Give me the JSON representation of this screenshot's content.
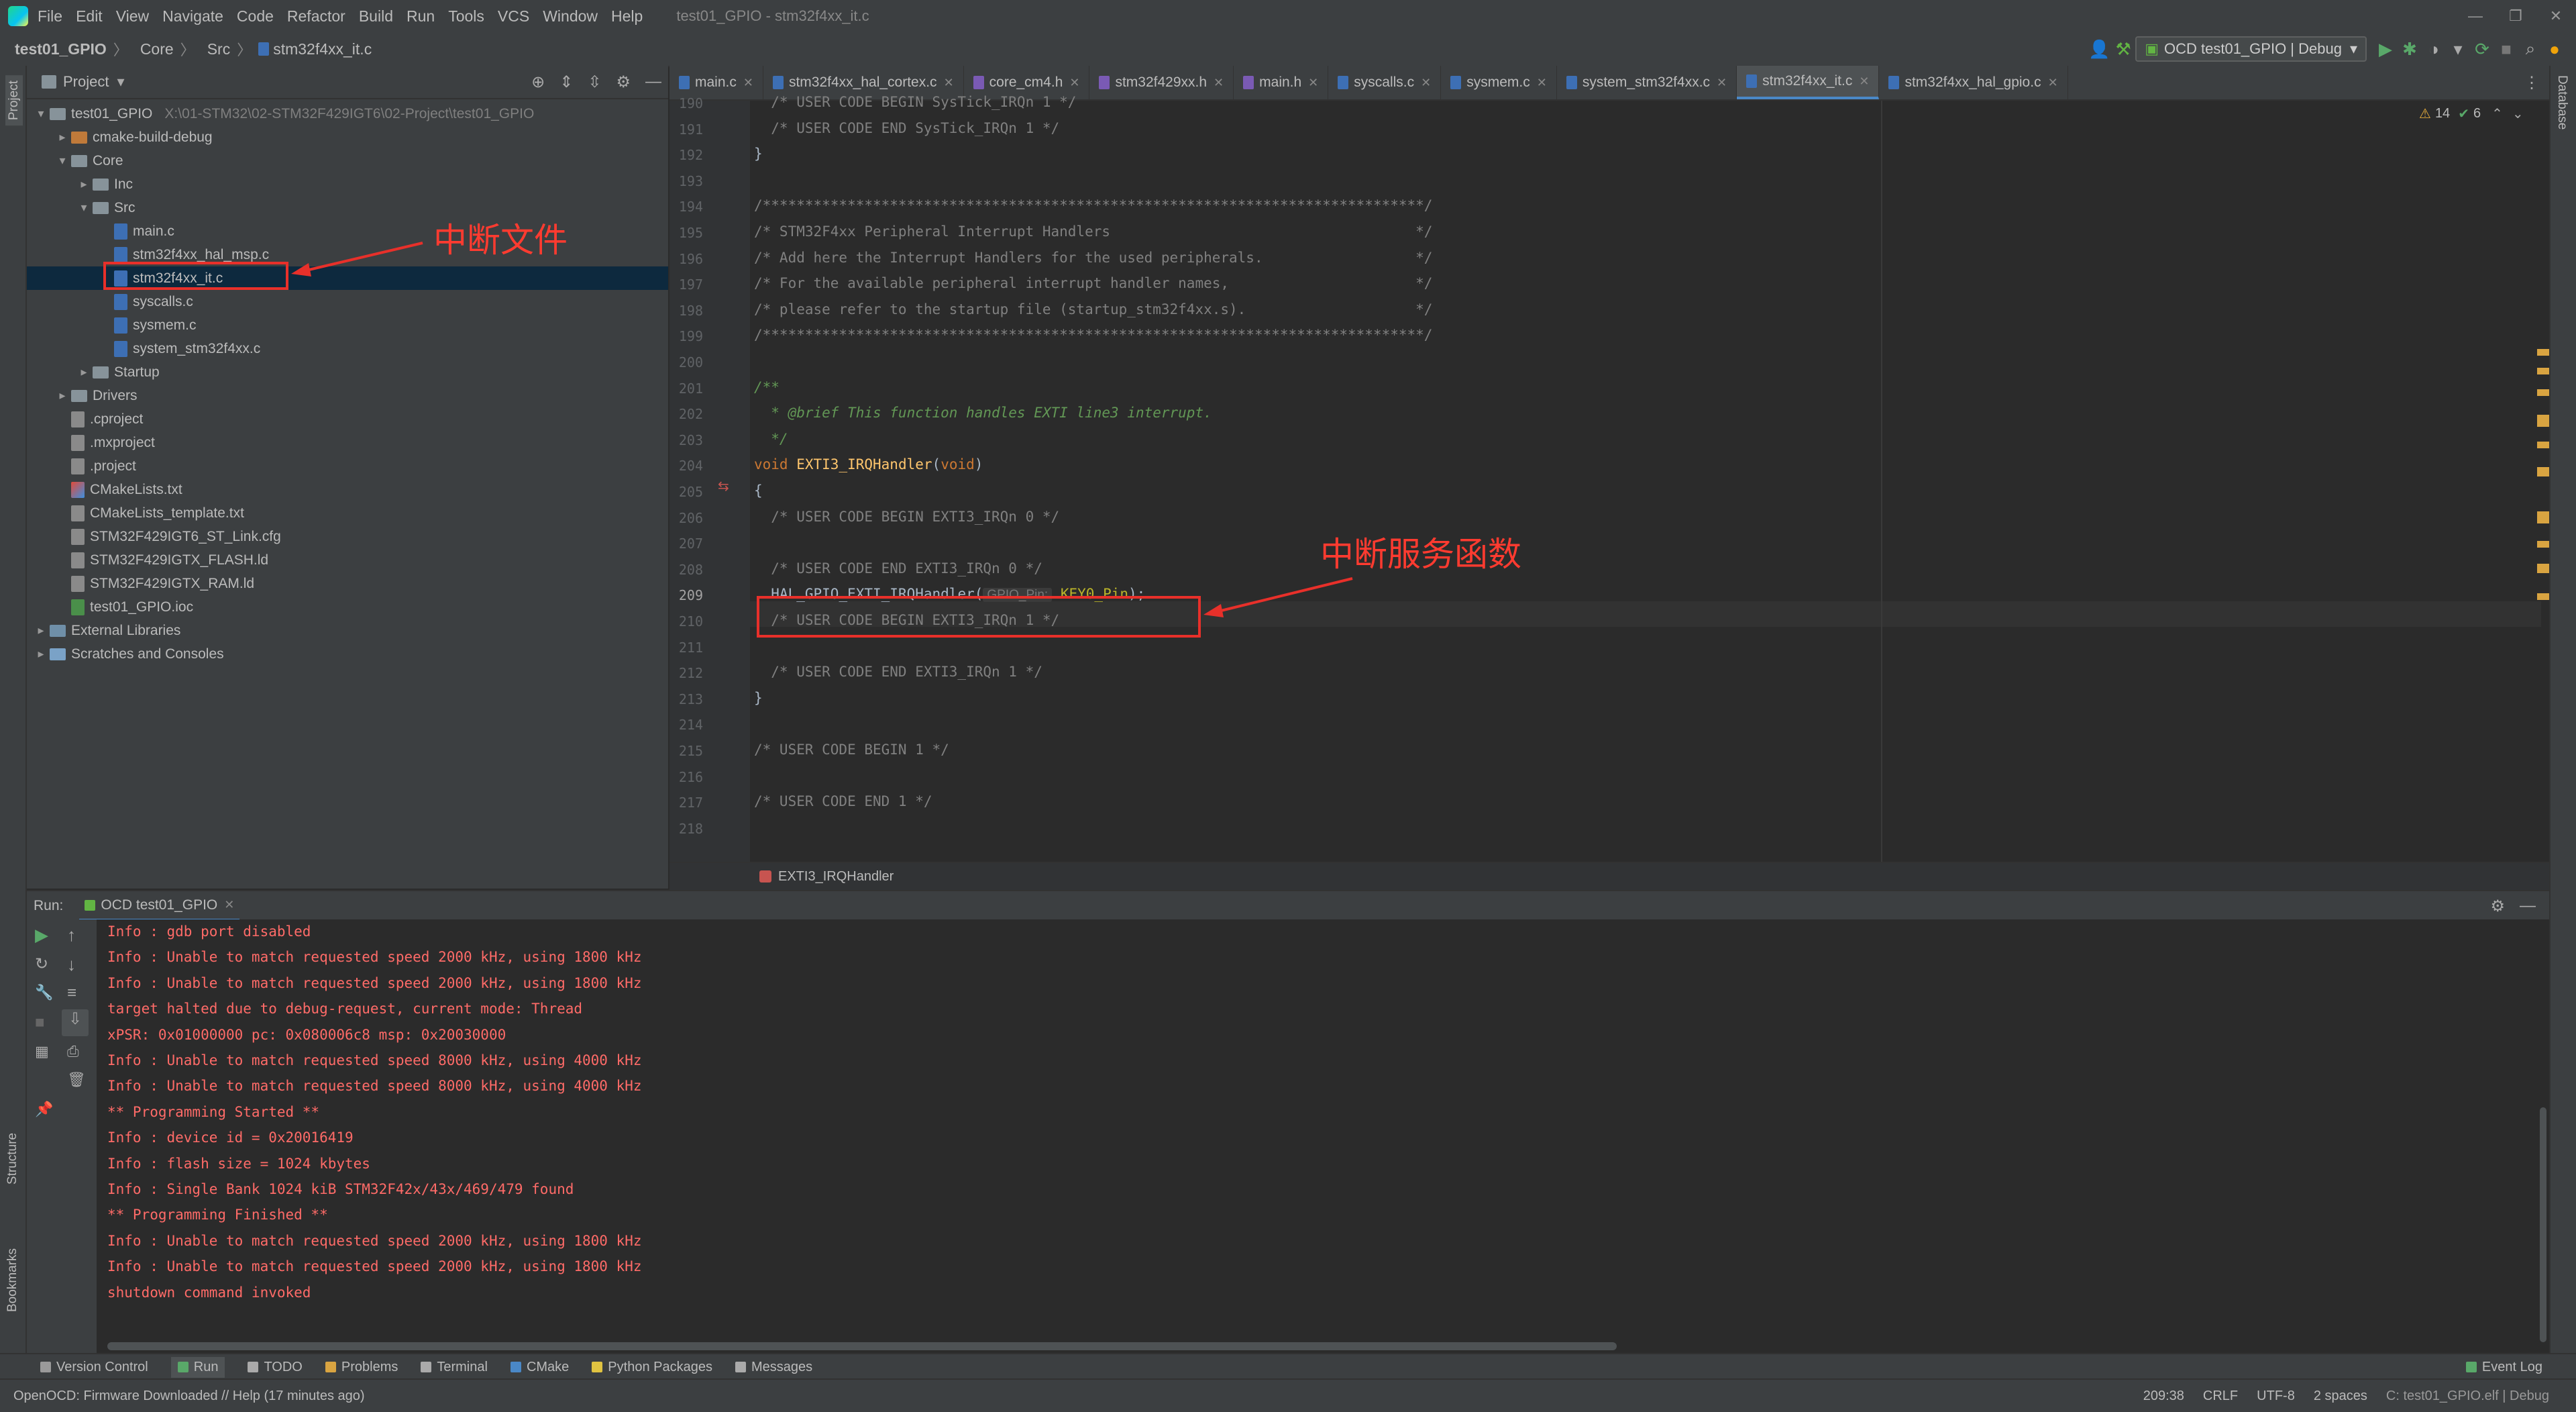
{
  "menubar": {
    "items": [
      "File",
      "Edit",
      "View",
      "Navigate",
      "Code",
      "Refactor",
      "Build",
      "Run",
      "Tools",
      "VCS",
      "Window",
      "Help"
    ],
    "window_title": "test01_GPIO - stm32f4xx_it.c"
  },
  "navbar": {
    "breadcrumbs": [
      "test01_GPIO",
      "Core",
      "Src",
      "stm32f4xx_it.c"
    ],
    "run_config": "OCD test01_GPIO | Debug"
  },
  "left_stripe": {
    "project_label": "Project",
    "structure_label": "Structure",
    "bookmarks_label": "Bookmarks"
  },
  "right_stripe": {
    "database_label": "Database"
  },
  "project_panel": {
    "title": "Project",
    "tree": [
      {
        "label": "test01_GPIO",
        "extra": "X:\\01-STM32\\02-STM32F429IGT6\\02-Project\\test01_GPIO",
        "kind": "folder"
      },
      {
        "label": "cmake-build-debug",
        "kind": "folder-orange"
      },
      {
        "label": "Core",
        "kind": "folder"
      },
      {
        "label": "Inc",
        "kind": "folder"
      },
      {
        "label": "Src",
        "kind": "folder"
      },
      {
        "label": "main.c",
        "kind": "c"
      },
      {
        "label": "stm32f4xx_hal_msp.c",
        "kind": "c"
      },
      {
        "label": "stm32f4xx_it.c",
        "kind": "c"
      },
      {
        "label": "syscalls.c",
        "kind": "c"
      },
      {
        "label": "sysmem.c",
        "kind": "c"
      },
      {
        "label": "system_stm32f4xx.c",
        "kind": "c"
      },
      {
        "label": "Startup",
        "kind": "folder"
      },
      {
        "label": "Drivers",
        "kind": "folder"
      },
      {
        "label": ".cproject",
        "kind": "txt"
      },
      {
        "label": ".mxproject",
        "kind": "txt"
      },
      {
        "label": ".project",
        "kind": "txt"
      },
      {
        "label": "CMakeLists.txt",
        "kind": "cm"
      },
      {
        "label": "CMakeLists_template.txt",
        "kind": "txt"
      },
      {
        "label": "STM32F429IGT6_ST_Link.cfg",
        "kind": "txt"
      },
      {
        "label": "STM32F429IGTX_FLASH.ld",
        "kind": "txt"
      },
      {
        "label": "STM32F429IGTX_RAM.ld",
        "kind": "txt"
      },
      {
        "label": "test01_GPIO.ioc",
        "kind": "ioc"
      },
      {
        "label": "External Libraries",
        "kind": "lib"
      },
      {
        "label": "Scratches and Consoles",
        "kind": "scratch"
      }
    ]
  },
  "editor": {
    "tabs": [
      {
        "label": "main.c",
        "kind": "c"
      },
      {
        "label": "stm32f4xx_hal_cortex.c",
        "kind": "c"
      },
      {
        "label": "core_cm4.h",
        "kind": "h"
      },
      {
        "label": "stm32f429xx.h",
        "kind": "h"
      },
      {
        "label": "main.h",
        "kind": "h"
      },
      {
        "label": "syscalls.c",
        "kind": "c"
      },
      {
        "label": "sysmem.c",
        "kind": "c"
      },
      {
        "label": "system_stm32f4xx.c",
        "kind": "c"
      },
      {
        "label": "stm32f4xx_it.c",
        "kind": "c",
        "active": true
      },
      {
        "label": "stm32f4xx_hal_gpio.c",
        "kind": "c"
      }
    ],
    "warnings": "14",
    "checks": "6",
    "lines": [
      {
        "n": "190",
        "t": "  /* USER CODE BEGIN SysTick_IRQn 1 */",
        "c": "cmt"
      },
      {
        "n": "191",
        "t": "  /* USER CODE END SysTick_IRQn 1 */",
        "c": "cmt"
      },
      {
        "n": "192",
        "t": "}",
        "c": "plain"
      },
      {
        "n": "193",
        "t": "",
        "c": "plain"
      },
      {
        "n": "194",
        "t": "/******************************************************************************/",
        "c": "cmt"
      },
      {
        "n": "195",
        "t": "/* STM32F4xx Peripheral Interrupt Handlers                                    */",
        "c": "cmt"
      },
      {
        "n": "196",
        "t": "/* Add here the Interrupt Handlers for the used peripherals.                  */",
        "c": "cmt"
      },
      {
        "n": "197",
        "t": "/* For the available peripheral interrupt handler names,                      */",
        "c": "cmt"
      },
      {
        "n": "198",
        "t": "/* please refer to the startup file (startup_stm32f4xx.s).                    */",
        "c": "cmt"
      },
      {
        "n": "199",
        "t": "/******************************************************************************/",
        "c": "cmt"
      },
      {
        "n": "200",
        "t": "",
        "c": "plain"
      },
      {
        "n": "201",
        "t": "/**",
        "c": "doc"
      },
      {
        "n": "202",
        "t": "  * @brief This function handles EXTI line3 interrupt.",
        "c": "doc"
      },
      {
        "n": "203",
        "t": "  */",
        "c": "doc"
      },
      {
        "n": "204",
        "t": "void EXTI3_IRQHandler(void)",
        "c": "decl"
      },
      {
        "n": "205",
        "t": "{",
        "c": "plain"
      },
      {
        "n": "206",
        "t": "  /* USER CODE BEGIN EXTI3_IRQn 0 */",
        "c": "cmt"
      },
      {
        "n": "207",
        "t": "",
        "c": "plain"
      },
      {
        "n": "208",
        "t": "  /* USER CODE END EXTI3_IRQn 0 */",
        "c": "cmt"
      },
      {
        "n": "209",
        "t": "  HAL_GPIO_EXTI_IRQHandler( GPIO_Pin: KEY0_Pin);",
        "c": "call"
      },
      {
        "n": "210",
        "t": "  /* USER CODE BEGIN EXTI3_IRQn 1 */",
        "c": "cmt"
      },
      {
        "n": "211",
        "t": "",
        "c": "plain"
      },
      {
        "n": "212",
        "t": "  /* USER CODE END EXTI3_IRQn 1 */",
        "c": "cmt"
      },
      {
        "n": "213",
        "t": "}",
        "c": "plain"
      },
      {
        "n": "214",
        "t": "",
        "c": "plain"
      },
      {
        "n": "215",
        "t": "/* USER CODE BEGIN 1 */",
        "c": "cmt"
      },
      {
        "n": "216",
        "t": "",
        "c": "plain"
      },
      {
        "n": "217",
        "t": "/* USER CODE END 1 */",
        "c": "cmt"
      },
      {
        "n": "218",
        "t": "",
        "c": "plain"
      }
    ],
    "call": {
      "fn": "HAL_GPIO_EXTI_IRQHandler(",
      "hint": "GPIO_Pin:",
      "arg": "KEY0_Pin",
      "end": ");"
    },
    "breadcrumb_fn": "EXTI3_IRQHandler"
  },
  "run_panel": {
    "label": "Run:",
    "tab": "OCD test01_GPIO",
    "lines": [
      "Info : gdb port disabled",
      "Info : Unable to match requested speed 2000 kHz, using 1800 kHz",
      "Info : Unable to match requested speed 2000 kHz, using 1800 kHz",
      "target halted due to debug-request, current mode: Thread",
      "xPSR: 0x01000000 pc: 0x080006c8 msp: 0x20030000",
      "Info : Unable to match requested speed 8000 kHz, using 4000 kHz",
      "Info : Unable to match requested speed 8000 kHz, using 4000 kHz",
      "** Programming Started **",
      "Info : device id = 0x20016419",
      "Info : flash size = 1024 kbytes",
      "Info : Single Bank 1024 kiB STM32F42x/43x/469/479 found",
      "** Programming Finished **",
      "Info : Unable to match requested speed 2000 kHz, using 1800 kHz",
      "Info : Unable to match requested speed 2000 kHz, using 1800 kHz",
      "shutdown command invoked"
    ]
  },
  "bottom_tools": [
    "Version Control",
    "Run",
    "TODO",
    "Problems",
    "Terminal",
    "CMake",
    "Python Packages",
    "Messages"
  ],
  "event_log": "Event Log",
  "status": {
    "message": "OpenOCD: Firmware Downloaded // Help (17 minutes ago)",
    "position": "209:38",
    "line_sep": "CRLF",
    "encoding": "UTF-8",
    "indent": "2 spaces",
    "context": "C: test01_GPIO.elf | Debug"
  },
  "annotations": {
    "interrupt_file": "中断文件",
    "isr_function": "中断服务函数"
  },
  "colors": {
    "accent": "#4a88c7",
    "annotation": "#e8302a",
    "console_text": "#ff6b68"
  }
}
